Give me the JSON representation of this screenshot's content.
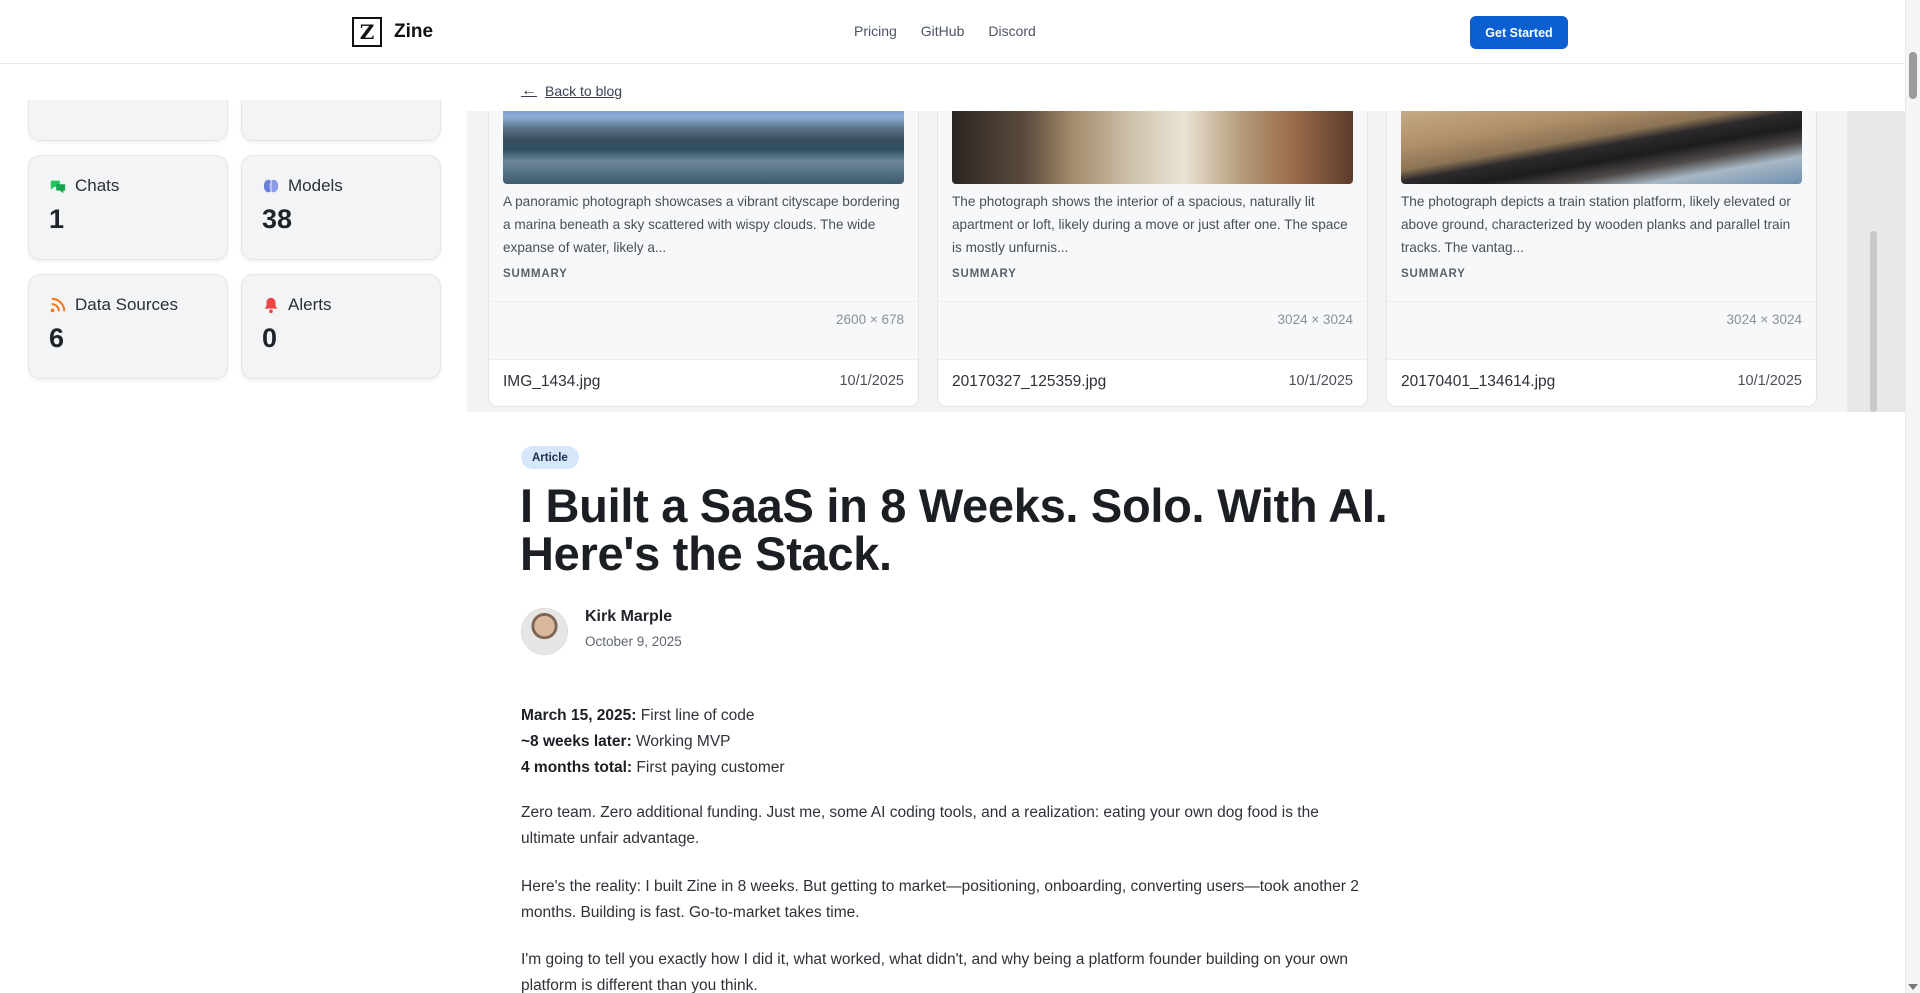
{
  "header": {
    "brand_logo": "Z",
    "brand_name": "Zine",
    "nav": [
      "Pricing",
      "GitHub",
      "Discord"
    ],
    "cta": "Get Started"
  },
  "back_link": "Back to blog",
  "widgets": [
    {
      "label": "Chats",
      "value": "1",
      "icon": "chat-icon",
      "color": "#22c55e"
    },
    {
      "label": "Models",
      "value": "38",
      "icon": "brain-icon",
      "color": "#6b7fd7"
    },
    {
      "label": "Data Sources",
      "value": "6",
      "icon": "rss-icon",
      "color": "#f97316"
    },
    {
      "label": "Alerts",
      "value": "0",
      "icon": "bell-icon",
      "color": "#ef4444"
    }
  ],
  "gallery": [
    {
      "description": "A panoramic photograph showcases a vibrant cityscape bordering a marina beneath a sky scattered with wispy clouds. The wide expanse of water, likely a...",
      "summary_label": "SUMMARY",
      "dims": "2600 × 678",
      "filename": "IMG_1434.jpg",
      "date": "10/1/2025"
    },
    {
      "description": "The photograph shows the interior of a spacious, naturally lit apartment or loft, likely during a move or just after one. The space is mostly unfurnis...",
      "summary_label": "SUMMARY",
      "dims": "3024 × 3024",
      "filename": "20170327_125359.jpg",
      "date": "10/1/2025"
    },
    {
      "description": "The photograph depicts a train station platform, likely elevated or above ground, characterized by wooden planks and parallel train tracks. The vantag...",
      "summary_label": "SUMMARY",
      "dims": "3024 × 3024",
      "filename": "20170401_134614.jpg",
      "date": "10/1/2025"
    }
  ],
  "article": {
    "badge": "Article",
    "title": "I Built a SaaS in 8 Weeks. Solo. With AI. Here's the Stack.",
    "author": "Kirk Marple",
    "date": "October 9, 2025",
    "timeline": [
      {
        "label": "March 15, 2025:",
        "text": "First line of code"
      },
      {
        "label": "~8 weeks later:",
        "text": "Working MVP"
      },
      {
        "label": "4 months total:",
        "text": "First paying customer"
      }
    ],
    "paragraphs": [
      "Zero team. Zero additional funding. Just me, some AI coding tools, and a realization: eating your own dog food is the ultimate unfair advantage.",
      "Here's the reality: I built Zine in 8 weeks. But getting to market—positioning, onboarding, converting users—took another 2 months. Building is fast. Go-to-market takes time.",
      "I'm going to tell you exactly how I did it, what worked, what didn't, and why being a platform founder building on your own platform is different than you think."
    ]
  },
  "colors": {
    "cta": "#0b5fd1",
    "badge_bg": "#d6e6fb",
    "text": "#1b1f24"
  }
}
